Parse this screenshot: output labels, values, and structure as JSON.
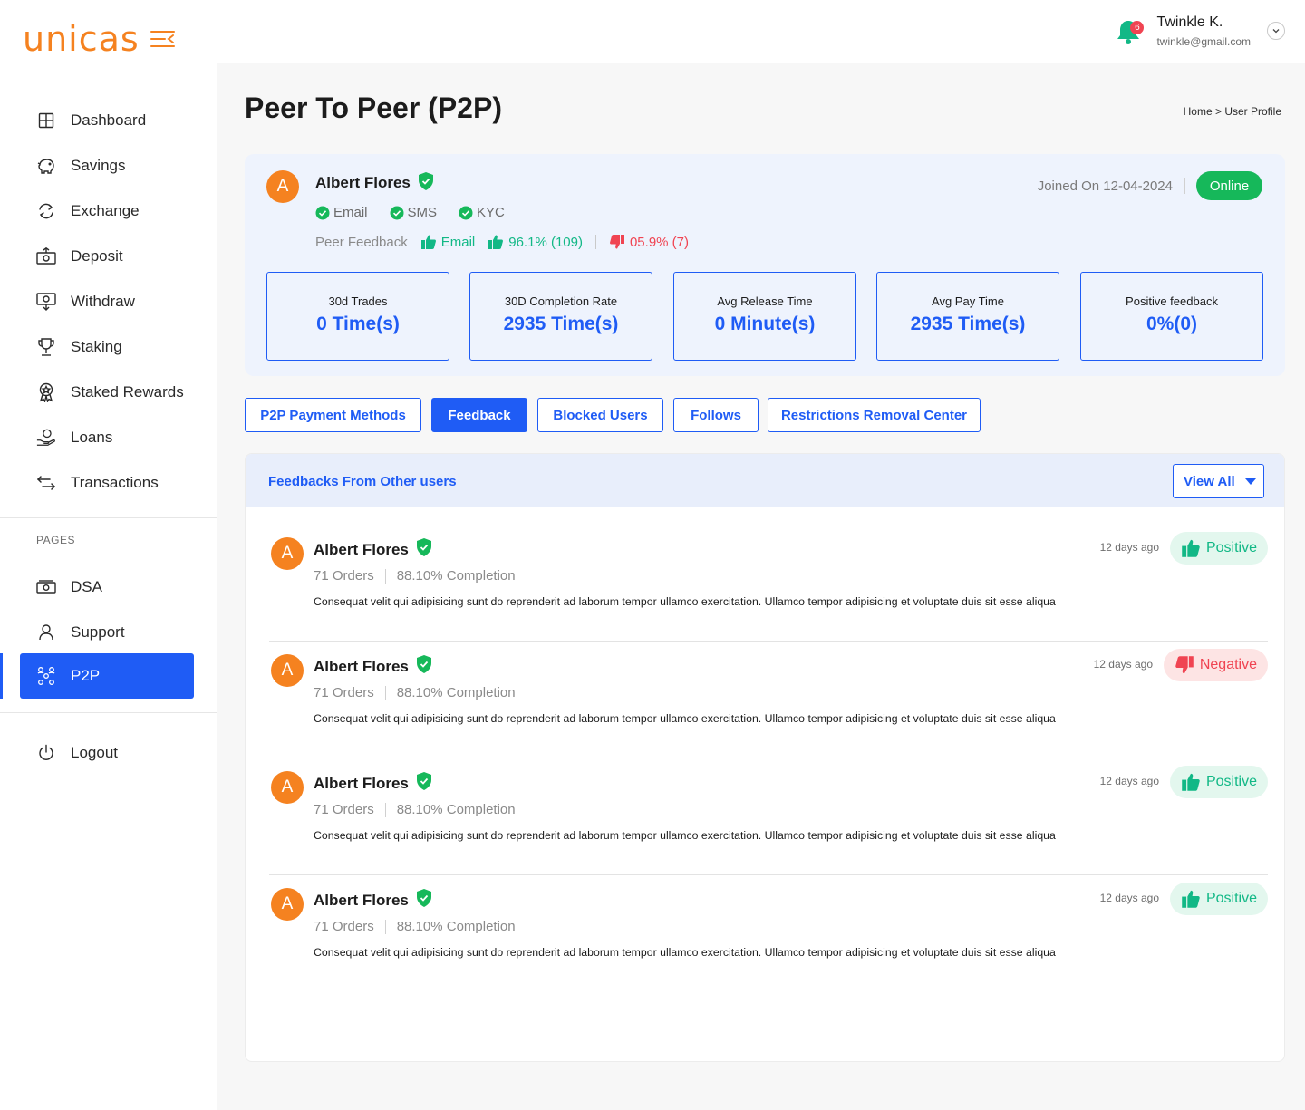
{
  "brand": {
    "logo_text": "unicas",
    "accent": "#1f5cf5",
    "brand_color": "#f58220"
  },
  "header": {
    "notification_count": "6",
    "user_name": "Twinkle K.",
    "user_email": "twinkle@gmail.com"
  },
  "sidebar": {
    "items": [
      {
        "label": "Dashboard",
        "icon": "dashboard-icon"
      },
      {
        "label": "Savings",
        "icon": "piggy-bank-icon"
      },
      {
        "label": "Exchange",
        "icon": "exchange-icon"
      },
      {
        "label": "Deposit",
        "icon": "deposit-icon"
      },
      {
        "label": "Withdraw",
        "icon": "withdraw-icon"
      },
      {
        "label": "Staking",
        "icon": "trophy-icon"
      },
      {
        "label": "Staked Rewards",
        "icon": "award-icon"
      },
      {
        "label": "Loans",
        "icon": "loan-hand-icon"
      },
      {
        "label": "Transactions",
        "icon": "transfer-arrows-icon"
      }
    ],
    "pages_label": "PAGES",
    "pages": [
      {
        "label": "DSA",
        "icon": "cash-icon"
      },
      {
        "label": "Support",
        "icon": "user-icon"
      },
      {
        "label": "P2P",
        "icon": "p2p-network-icon",
        "active": true
      }
    ],
    "logout": "Logout"
  },
  "page": {
    "title": "Peer To Peer (P2P)",
    "breadcrumb_home": "Home >",
    "breadcrumb_current": "User Profile"
  },
  "profile": {
    "avatar_letter": "A",
    "name": "Albert Flores",
    "verifications": [
      "Email",
      "SMS",
      "KYC"
    ],
    "peer_feedback_label": "Peer Feedback",
    "positive_label": "Email",
    "positive_value": "96.1% (109)",
    "negative_value": "05.9% (7)",
    "joined": "Joined On 12-04-2024",
    "status": "Online",
    "status_color": "#16b85a",
    "stats": [
      {
        "label": "30d Trades",
        "value": "0 Time(s)"
      },
      {
        "label": "30D Completion Rate",
        "value": "2935 Time(s)"
      },
      {
        "label": "Avg Release Time",
        "value": "0 Minute(s)"
      },
      {
        "label": "Avg Pay Time",
        "value": "2935 Time(s)"
      },
      {
        "label": "Positive feedback",
        "value": "0%(0)"
      }
    ]
  },
  "tabs": [
    {
      "label": "P2P Payment Methods"
    },
    {
      "label": "Feedback",
      "active": true
    },
    {
      "label": "Blocked Users"
    },
    {
      "label": "Follows"
    },
    {
      "label": "Restrictions Removal Center"
    }
  ],
  "feedback_panel": {
    "title": "Feedbacks From Other users",
    "filter_label": "View All",
    "items": [
      {
        "avatar": "A",
        "name": "Albert Flores",
        "orders": "71 Orders",
        "completion": "88.10% Completion",
        "text": "Consequat velit qui adipisicing sunt do reprenderit ad laborum tempor ullamco exercitation. Ullamco tempor adipisicing et voluptate duis sit esse aliqua",
        "time": "12 days ago",
        "sentiment": "Positive"
      },
      {
        "avatar": "A",
        "name": "Albert Flores",
        "orders": "71 Orders",
        "completion": "88.10% Completion",
        "text": "Consequat velit qui adipisicing sunt do reprenderit ad laborum tempor ullamco exercitation. Ullamco tempor adipisicing et voluptate duis sit esse aliqua",
        "time": "12 days ago",
        "sentiment": "Negative"
      },
      {
        "avatar": "A",
        "name": "Albert Flores",
        "orders": "71 Orders",
        "completion": "88.10% Completion",
        "text": "Consequat velit qui adipisicing sunt do reprenderit ad laborum tempor ullamco exercitation. Ullamco tempor adipisicing et voluptate duis sit esse aliqua",
        "time": "12 days ago",
        "sentiment": "Positive"
      },
      {
        "avatar": "A",
        "name": "Albert Flores",
        "orders": "71 Orders",
        "completion": "88.10% Completion",
        "text": "Consequat velit qui adipisicing sunt do reprenderit ad laborum tempor ullamco exercitation. Ullamco tempor adipisicing et voluptate duis sit esse aliqua",
        "time": "12 days ago",
        "sentiment": "Positive"
      }
    ]
  }
}
